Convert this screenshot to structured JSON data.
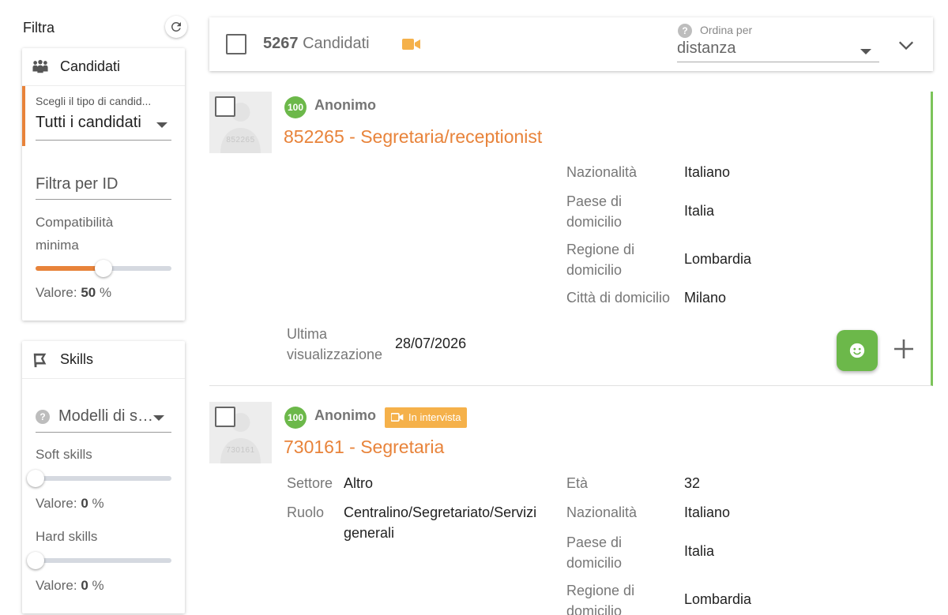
{
  "sidebar": {
    "filter_title": "Filtra",
    "candidati_card": {
      "header": "Candidati",
      "type_hint": "Scegli il tipo di candid...",
      "type_value": "Tutti i candidati",
      "id_placeholder": "Filtra per ID",
      "compat_label": "Compatibilità minima",
      "compat_value_prefix": "Valore:",
      "compat_value": "50",
      "compat_unit": "%",
      "compat_fraction": 0.5
    },
    "skills_card": {
      "header": "Skills",
      "modelli_placeholder": "Modelli di so...",
      "soft_label": "Soft skills",
      "soft_value_prefix": "Valore:",
      "soft_value": "0",
      "soft_unit": "%",
      "hard_label": "Hard skills",
      "hard_value_prefix": "Valore:",
      "hard_value": "0",
      "hard_unit": "%"
    }
  },
  "topbar": {
    "count": "5267",
    "count_label": "Candidati",
    "order_label": "Ordina per",
    "order_value": "distanza"
  },
  "candidates": [
    {
      "avatar_id": "852265",
      "score": "100",
      "name": "Anonimo",
      "title": "852265 - Segretaria/receptionist",
      "fields_right": [
        {
          "label": "Nazionalità",
          "value": "Italiano"
        },
        {
          "label": "Paese di domicilio",
          "value": "Italia"
        },
        {
          "label": "Regione di domicilio",
          "value": "Lombardia"
        },
        {
          "label": "Città di domicilio",
          "value": "Milano"
        }
      ],
      "last_view_label": "Ultima visualizzazione",
      "last_view_value": "28/07/2026"
    },
    {
      "avatar_id": "730161",
      "score": "100",
      "name": "Anonimo",
      "badge": "In intervista",
      "title": "730161 - Segretaria",
      "fields_left": [
        {
          "label": "Settore",
          "value": "Altro"
        },
        {
          "label": "Ruolo",
          "value": "Centralino/Segretariato/Servizi generali"
        }
      ],
      "fields_right": [
        {
          "label": "Età",
          "value": "32"
        },
        {
          "label": "Nazionalità",
          "value": "Italiano"
        },
        {
          "label": "Paese di domicilio",
          "value": "Italia"
        },
        {
          "label": "Regione di domicilio",
          "value": "Lombardia"
        }
      ]
    }
  ],
  "colors": {
    "accent": "#e8833a",
    "success": "#6cb84a",
    "badge": "#f5b14a"
  }
}
